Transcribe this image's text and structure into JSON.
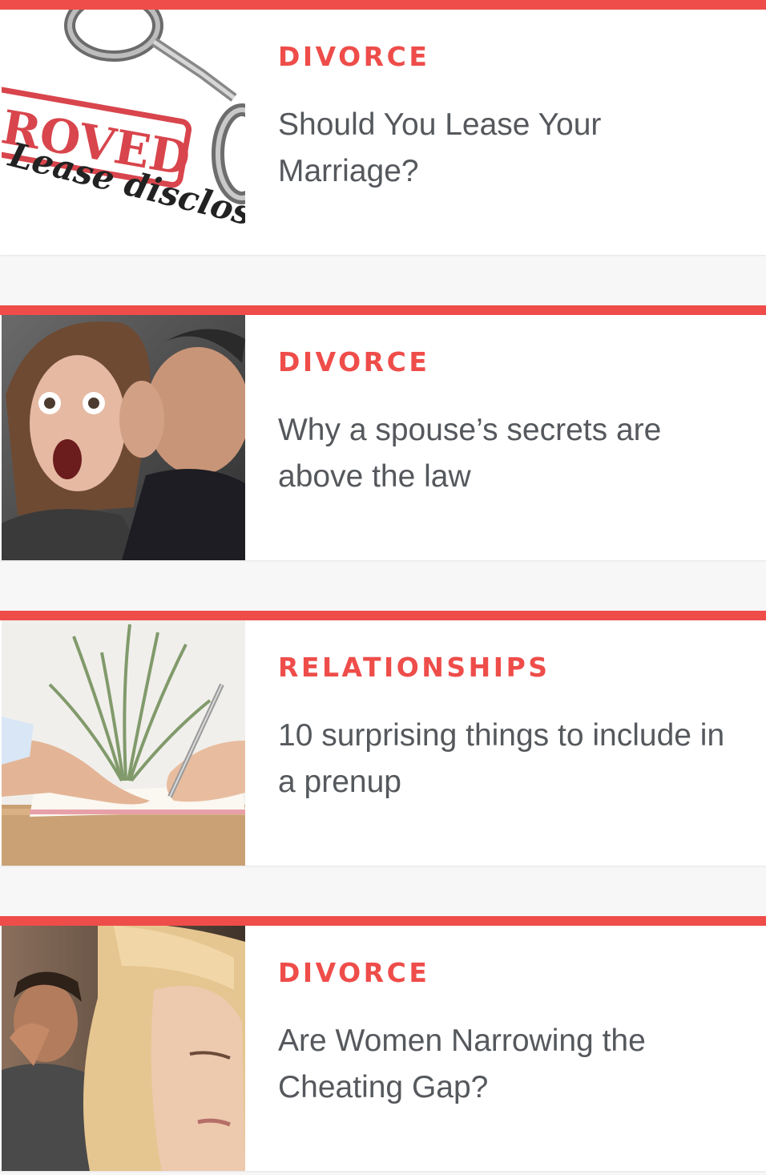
{
  "accent_color": "#ee4d4a",
  "articles": [
    {
      "category": "DIVORCE",
      "title": "Should You Lease Your Marriage?",
      "image_icon": "lease-document-with-handcuffs-image",
      "image_text_stamp": "ROVED",
      "image_text_doc": "Lease disclosu"
    },
    {
      "category": "DIVORCE",
      "title": "Why a spouse’s secrets are above the law",
      "image_icon": "man-whispering-to-shocked-woman-image"
    },
    {
      "category": "RELATIONSHIPS",
      "title": "10 surprising things to include in a prenup",
      "image_icon": "hands-signing-document-image"
    },
    {
      "category": "DIVORCE",
      "title": "Are Women Narrowing the Cheating Gap?",
      "image_icon": "upset-woman-and-man-image"
    }
  ]
}
